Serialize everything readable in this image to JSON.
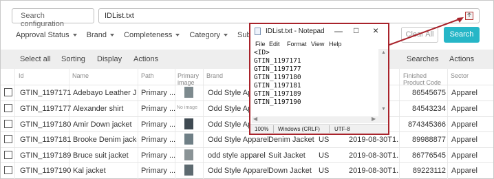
{
  "search": {
    "config_placeholder": "Search configuration",
    "file_value": "IDList.txt"
  },
  "filters": [
    {
      "label": "Approval Status"
    },
    {
      "label": "Brand"
    },
    {
      "label": "Completeness"
    },
    {
      "label": "Category"
    },
    {
      "label": "Subcategory"
    }
  ],
  "buttons": {
    "clear": "Clear All",
    "search": "Search"
  },
  "toolbar": {
    "select_all": "Select all",
    "sorting": "Sorting",
    "display": "Display",
    "actions": "Actions",
    "searches": "Searches",
    "actions_right": "Actions"
  },
  "table": {
    "headers": {
      "id": "Id",
      "name": "Name",
      "path": "Path",
      "primary_image": "Primary image",
      "brand": "Brand",
      "finished_code": "Finished Product Code",
      "sector": "Sector"
    },
    "rows": [
      {
        "id": "GTIN_1197171",
        "name": "Adebayo Leather J...",
        "path": "Primary ...",
        "image": "thumb",
        "brand": "Odd Style Apparel",
        "type": "",
        "country": "",
        "date": "",
        "code": "86545675",
        "sector": "Apparel"
      },
      {
        "id": "GTIN_1197177",
        "name": "Alexander shirt",
        "path": "Primary ...",
        "image": "none",
        "brand": "Odd Style Apparel",
        "type": "",
        "country": "",
        "date": "",
        "code": "84543234",
        "sector": "Apparel"
      },
      {
        "id": "GTIN_1197180",
        "name": "Amir Down jacket",
        "path": "Primary ...",
        "image": "thumb",
        "brand": "Odd Style Apparel",
        "type": "",
        "country": "",
        "date": "",
        "code": "874345366",
        "sector": "Apparel"
      },
      {
        "id": "GTIN_1197181",
        "name": "Brooke Denim jacket",
        "path": "Primary ...",
        "image": "thumb",
        "brand": "Odd Style Apparel",
        "type": "Denim Jacket",
        "country": "US",
        "date": "2019-08-30T1...",
        "code": "89988877",
        "sector": "Apparel"
      },
      {
        "id": "GTIN_1197189",
        "name": "Bruce suit jacket",
        "path": "Primary ...",
        "image": "thumb",
        "brand": "odd style apparel",
        "type": "Suit Jacket",
        "country": "US",
        "date": "2019-08-30T1...",
        "code": "86776545",
        "sector": "Apparel"
      },
      {
        "id": "GTIN_1197190",
        "name": "Kal jacket",
        "path": "Primary ...",
        "image": "thumb",
        "brand": "Odd Style Apparel",
        "type": "Down Jacket",
        "country": "US",
        "date": "2019-08-30T1...",
        "code": "89223112",
        "sector": "Apparel"
      }
    ],
    "no_image_text": "No image"
  },
  "notepad": {
    "title": "IDList.txt - Notepad",
    "menu": [
      "File",
      "Edit",
      "Format",
      "View",
      "Help"
    ],
    "lines": [
      "<ID>",
      "GTIN_1197171",
      "GTIN_1197177",
      "GTIN_1197180",
      "GTIN_1197181",
      "GTIN_1197189",
      "GTIN_1197190"
    ],
    "status": {
      "zoom": "100%",
      "line_endings": "Windows (CRLF)",
      "encoding": "UTF-8"
    }
  },
  "colors": {
    "accent": "#26b6c7",
    "highlight": "#a8232b"
  }
}
